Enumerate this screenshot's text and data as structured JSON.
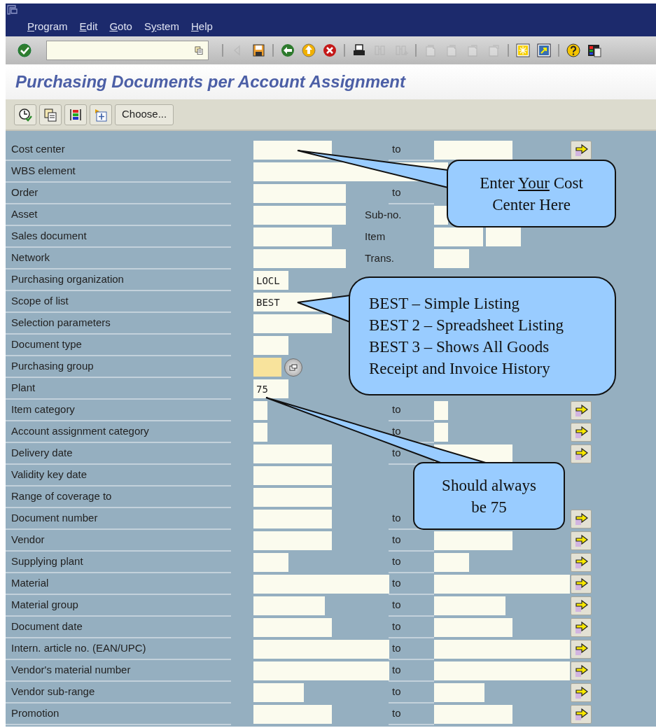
{
  "window": {
    "menu": [
      {
        "key": "P",
        "suffix": "rogram"
      },
      {
        "key": "E",
        "suffix": "dit"
      },
      {
        "key": "G",
        "suffix": "oto"
      },
      {
        "prefix": "S",
        "key": "y",
        "suffix": "stem"
      },
      {
        "key": "H",
        "suffix": "elp"
      }
    ]
  },
  "toolbar": [
    {
      "kind": "enter",
      "disabled": false
    },
    {
      "kind": "command",
      "disabled": false
    },
    {
      "kind": "nav-left",
      "disabled": true
    },
    {
      "kind": "save",
      "disabled": false
    },
    {
      "kind": "back",
      "disabled": false
    },
    {
      "kind": "exit",
      "disabled": false
    },
    {
      "kind": "cancel",
      "disabled": false
    },
    {
      "kind": "print",
      "disabled": false
    },
    {
      "kind": "find",
      "disabled": true
    },
    {
      "kind": "find-next",
      "disabled": true
    },
    {
      "kind": "first-page",
      "disabled": true
    },
    {
      "kind": "prev-page",
      "disabled": true
    },
    {
      "kind": "next-page",
      "disabled": true
    },
    {
      "kind": "last-page",
      "disabled": true
    },
    {
      "kind": "new-session",
      "disabled": false
    },
    {
      "kind": "shortcut",
      "disabled": false
    },
    {
      "kind": "help",
      "disabled": false
    },
    {
      "kind": "layout",
      "disabled": false
    }
  ],
  "title": "Purchasing Documents per Account Assignment",
  "app_toolbar": {
    "icons": [
      {
        "kind": "execute"
      },
      {
        "kind": "variant"
      },
      {
        "kind": "columns"
      },
      {
        "kind": "options"
      }
    ],
    "choose_button": "Choose..."
  },
  "rows": [
    {
      "label": "Cost center",
      "low": {
        "kind": "input"
      },
      "mid": {
        "text": "to",
        "kind": "range"
      },
      "multi": true
    },
    {
      "label": "WBS element",
      "low": {
        "kind": "input"
      },
      "multi": false
    },
    {
      "label": "Order",
      "low": {
        "kind": "input"
      },
      "mid": {
        "text": "to",
        "kind": "range"
      },
      "multi": false
    },
    {
      "label": "Asset",
      "low": {
        "kind": "input"
      },
      "mid": {
        "text": "Sub-no.",
        "kind": "label"
      },
      "multi": false
    },
    {
      "label": "Sales document",
      "low": {
        "kind": "input"
      },
      "mid": {
        "text": "Item",
        "kind": "label"
      },
      "multi": false
    },
    {
      "label": "Network",
      "low": {
        "kind": "input"
      },
      "mid": {
        "text": "Trans.",
        "kind": "label"
      },
      "multi": false
    },
    {
      "label": "Purchasing organization",
      "low": {
        "kind": "input",
        "value": "LOCL"
      },
      "multi": false
    },
    {
      "label": "Scope of list",
      "low": {
        "kind": "input",
        "value": "BEST"
      },
      "multi": false
    },
    {
      "label": "Selection parameters",
      "low": {
        "kind": "input"
      },
      "multi": false
    },
    {
      "label": "Document type",
      "low": {
        "kind": "input"
      },
      "multi": false
    },
    {
      "label": "Purchasing group",
      "low": {
        "kind": "required"
      },
      "multi": false
    },
    {
      "label": "Plant",
      "low": {
        "kind": "input",
        "value": "75"
      },
      "multi": false
    },
    {
      "label": "Item category",
      "low": {
        "kind": "input"
      },
      "mid": {
        "text": "to",
        "kind": "range"
      },
      "multi": true
    },
    {
      "label": "Account assignment category",
      "low": {
        "kind": "input"
      },
      "mid": {
        "text": "to",
        "kind": "range"
      },
      "multi": true
    },
    {
      "label": "Delivery date",
      "low": {
        "kind": "input"
      },
      "mid": {
        "text": "to",
        "kind": "range"
      },
      "multi": true
    },
    {
      "label": "Validity key date",
      "low": {
        "kind": "input"
      },
      "multi": false
    },
    {
      "label": "Range of coverage to",
      "low": {
        "kind": "input"
      },
      "multi": false
    },
    {
      "label": "Document number",
      "low": {
        "kind": "input"
      },
      "mid": {
        "text": "to",
        "kind": "range"
      },
      "multi": true
    },
    {
      "label": "Vendor",
      "low": {
        "kind": "input"
      },
      "mid": {
        "text": "to",
        "kind": "range"
      },
      "multi": true
    },
    {
      "label": "Supplying plant",
      "low": {
        "kind": "input"
      },
      "mid": {
        "text": "to",
        "kind": "range"
      },
      "multi": true
    },
    {
      "label": "Material",
      "low": {
        "kind": "input"
      },
      "mid": {
        "text": "to",
        "kind": "range"
      },
      "multi": true
    },
    {
      "label": "Material group",
      "low": {
        "kind": "input"
      },
      "mid": {
        "text": "to",
        "kind": "range"
      },
      "multi": true
    },
    {
      "label": "Document date",
      "low": {
        "kind": "input"
      },
      "mid": {
        "text": "to",
        "kind": "range"
      },
      "multi": true
    },
    {
      "label": "Intern. article no. (EAN/UPC)",
      "low": {
        "kind": "input"
      },
      "mid": {
        "text": "to",
        "kind": "range"
      },
      "multi": true
    },
    {
      "label": "Vendor's material number",
      "low": {
        "kind": "input"
      },
      "mid": {
        "text": "to",
        "kind": "range"
      },
      "multi": true
    },
    {
      "label": "Vendor sub-range",
      "low": {
        "kind": "input"
      },
      "mid": {
        "text": "to",
        "kind": "range"
      },
      "multi": true
    },
    {
      "label": "Promotion",
      "low": {
        "kind": "input"
      },
      "mid": {
        "text": "to",
        "kind": "range"
      },
      "multi": true
    }
  ],
  "callouts": [
    {
      "lines": [
        [
          {
            "text": "Enter "
          },
          {
            "text": "Your",
            "underline": true
          },
          {
            "text": " Cost"
          }
        ],
        [
          {
            "text": "Center Here"
          }
        ]
      ]
    },
    {
      "lines": [
        [
          {
            "text": "BEST – Simple Listing"
          }
        ],
        [
          {
            "text": "BEST 2 – Spreadsheet Listing"
          }
        ],
        [
          {
            "text": "BEST 3 – Shows All Goods"
          }
        ],
        [
          {
            "text": "Receipt and Invoice History"
          }
        ]
      ]
    },
    {
      "lines": [
        [
          {
            "text": "Should always"
          }
        ],
        [
          {
            "text": "be 75"
          }
        ]
      ]
    }
  ]
}
